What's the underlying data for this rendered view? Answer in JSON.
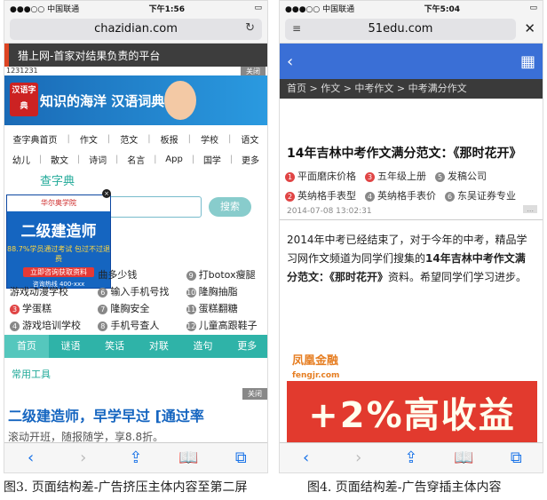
{
  "p1": {
    "status": {
      "carrier": "●●●○○ 中国联通",
      "time": "下午1:56",
      "battery": "▭"
    },
    "url": "chazidian.com",
    "ad_top": "猎上网-首家对结果负责的平台",
    "ad_num": "1231231",
    "close": "关闭",
    "banner_logo": "汉语字典",
    "banner_text": "知识的海洋 汉语词典",
    "nav": [
      [
        "查字典首页",
        "作文",
        "范文",
        "板报",
        "学校",
        "语文"
      ],
      [
        "幼儿",
        "散文",
        "诗词",
        "名言",
        "App",
        "国学",
        "更多"
      ]
    ],
    "dict_logo": "查字典",
    "search_btn": "搜索",
    "float_ad": {
      "head": "华尔奥学院",
      "title": "二级建造师",
      "sub": "88.7%学员通过考试 包过不过退费",
      "btn": "立即咨询获取资料",
      "phone": "咨询热线 400-xxx"
    },
    "list": [
      [
        [
          "",
          "曲多少钱"
        ],
        [
          "9",
          "打botox瘦腿"
        ]
      ],
      [
        [
          "",
          "游戏动漫学校"
        ],
        [
          "6",
          "输入手机号找"
        ],
        [
          "10",
          "隆胸抽脂"
        ]
      ],
      [
        [
          "3",
          "学蛋糕"
        ],
        [
          "7",
          "隆胸安全"
        ],
        [
          "11",
          "蛋糕翻糖"
        ]
      ],
      [
        [
          "4",
          "游戏培训学校"
        ],
        [
          "8",
          "手机号查人"
        ],
        [
          "12",
          "儿童高跟鞋子"
        ]
      ]
    ],
    "list_partial": [
      "",
      "抽脂多少钱"
    ],
    "tabs": [
      "首页",
      "谜语",
      "笑话",
      "对联",
      "造句",
      "更多"
    ],
    "common": "常用工具",
    "ad2": {
      "title": "二级建造师，早学早过 [通过率",
      "sub": "滚动开班，随报随学，享8.8折。"
    }
  },
  "p2": {
    "status": {
      "carrier": "●●●○○ 中国联通",
      "time": "下午5:04",
      "battery": "▭"
    },
    "url": "51edu.com",
    "breadcrumb": "首页 > 作文 > 中考作文 > 中考满分作文",
    "title": "14年吉林中考作文满分范文：《那时花开》",
    "links": [
      [
        [
          "1",
          "平面磨床价格"
        ],
        [
          "3",
          "五年级上册"
        ],
        [
          "5",
          "发稿公司"
        ]
      ],
      [
        [
          "2",
          "英纳格手表型"
        ],
        [
          "4",
          "英纳格手表价"
        ],
        [
          "6",
          "东吴证券专业"
        ]
      ]
    ],
    "date": "2014-07-08 13:02:31",
    "para_plain": "2014年中考已经结束了，对于今年的中考，精品学习网作文频道为同学们搜集的",
    "para_bold": "14年吉林中考作文满分范文",
    "para_bold2": "：《那时花开》",
    "para_tail": "资料。希望同学们学习进步。",
    "ad3": {
      "head": "凤凰金融",
      "url": "fengjr.com",
      "big": "+2%高收益"
    }
  },
  "captions": {
    "left": "图3. 页面结构差-广告挤压主体内容至第二屏",
    "right": "图4. 页面结构差-广告穿插主体内容"
  },
  "toolbar": [
    "‹",
    "›",
    "⇪",
    "📖",
    "⧉"
  ]
}
